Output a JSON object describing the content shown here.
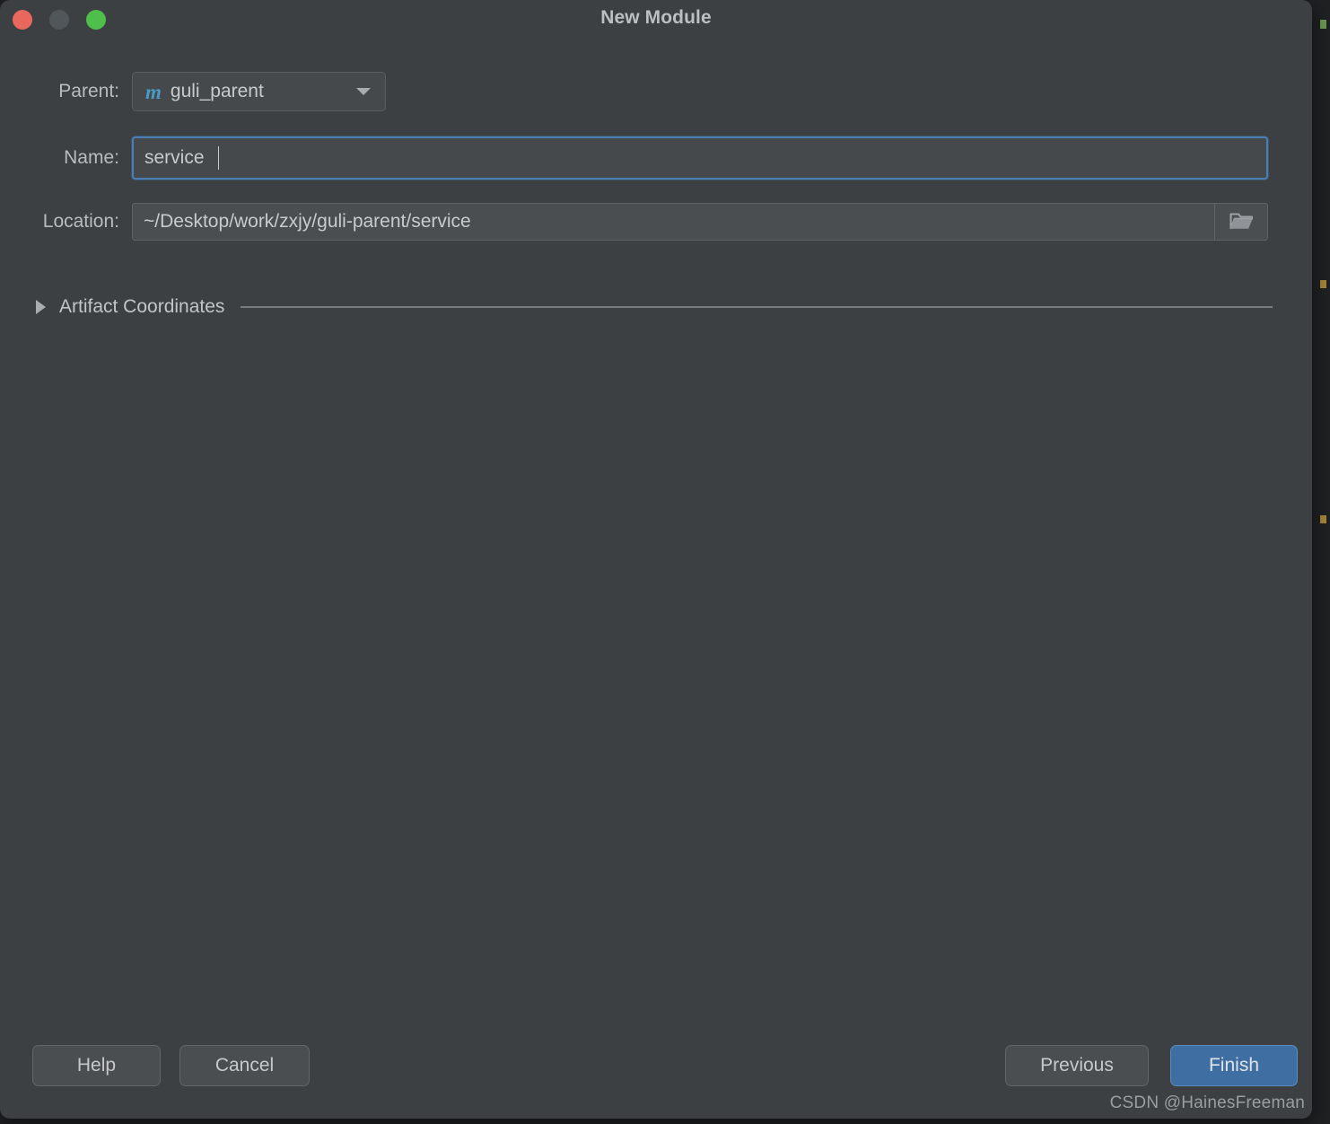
{
  "window": {
    "title": "New Module",
    "traffic_lights": [
      {
        "name": "close",
        "color": "#e8685e"
      },
      {
        "name": "minimize",
        "color": "#50565a"
      },
      {
        "name": "maximize",
        "color": "#4fbf4b"
      }
    ]
  },
  "form": {
    "parent": {
      "label": "Parent:",
      "icon": "maven-module-icon",
      "icon_glyph": "m",
      "value": "guli_parent",
      "dropdown_icon": "chevron-down-icon"
    },
    "name": {
      "label": "Name:",
      "value": "service",
      "placeholder": "",
      "focused": true
    },
    "location": {
      "label": "Location:",
      "value": "~/Desktop/work/zxjy/guli-parent/service",
      "placeholder": "",
      "browse_icon": "folder-open-icon"
    },
    "artifact_coordinates": {
      "label": "Artifact Coordinates",
      "expanded": false,
      "toggle_icon": "triangle-right-icon"
    }
  },
  "footer": {
    "help_label": "Help",
    "cancel_label": "Cancel",
    "previous_label": "Previous",
    "finish_label": "Finish"
  },
  "watermark": {
    "text": "CSDN @HainesFreeman"
  },
  "colors": {
    "dialog_background": "#3c4043",
    "field_background": "#45494c",
    "focus_border": "#4a7fb5",
    "primary_button": "#3f6ea3",
    "maven_icon": "#4a9bc4",
    "text": "#c8cbce"
  }
}
